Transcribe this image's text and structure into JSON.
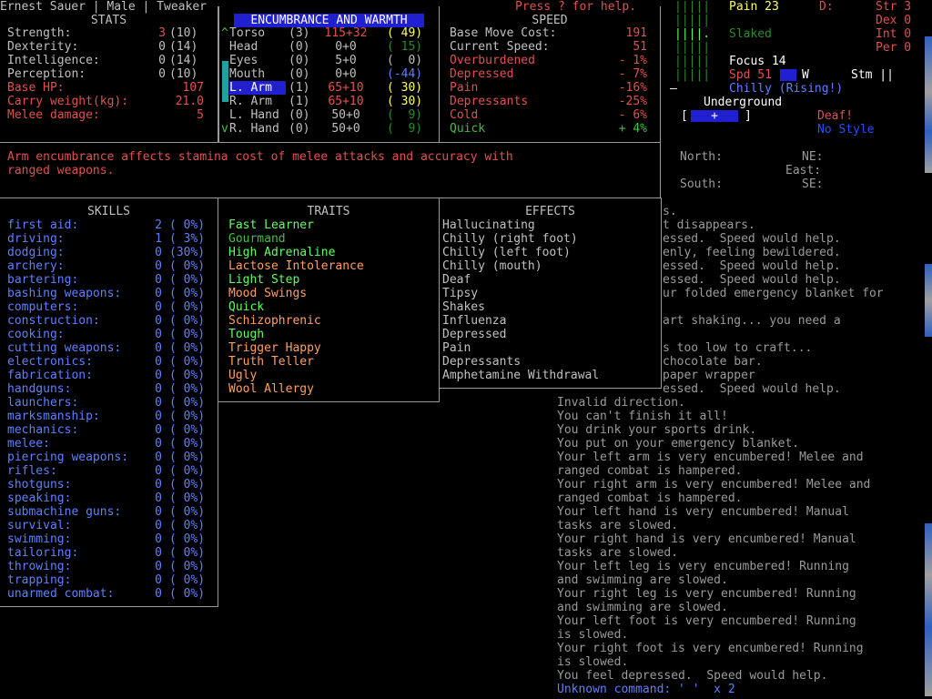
{
  "title": "Ernest Sauer | Male | Tweaker",
  "help": "Press ? for help.",
  "stats": {
    "header": "STATS",
    "rows": [
      {
        "label": "Strength:",
        "val": "3",
        "base": "(10)"
      },
      {
        "label": "Dexterity:",
        "val": "0",
        "base": "(14)"
      },
      {
        "label": "Intelligence:",
        "val": "0",
        "base": "(14)"
      },
      {
        "label": "Perception:",
        "val": "0",
        "base": "(10)"
      }
    ],
    "base_hp_label": "Base HP:",
    "base_hp": "107",
    "carry_label": "Carry weight(kg):",
    "carry": "21.0",
    "melee_label": "Melee damage:",
    "melee": "5"
  },
  "encumbrance": {
    "header": "ENCUMBRANCE AND WARMTH",
    "rows": [
      {
        "mark": "^",
        "part": "Torso",
        "layers": "(3)",
        "enc": "115+32",
        "warm": "( 49)",
        "enc_color": "red",
        "warm_color": "yel"
      },
      {
        "mark": "",
        "part": "Head",
        "layers": "(0)",
        "enc": "0+0",
        "warm": "( 15)",
        "enc_color": "gray",
        "warm_color": "dgrn"
      },
      {
        "mark": "",
        "part": "Eyes",
        "layers": "(0)",
        "enc": "5+0",
        "warm": "(  0)",
        "enc_color": "gray",
        "warm_color": "gray"
      },
      {
        "mark": "",
        "part": "Mouth",
        "layers": "(0)",
        "enc": "0+0",
        "warm": "(-44)",
        "enc_color": "gray",
        "warm_color": "blue"
      },
      {
        "mark": "",
        "part": "L. Arm",
        "layers": "(1)",
        "enc": "65+10",
        "warm": "( 30)",
        "enc_color": "red",
        "warm_color": "yel",
        "selected": true
      },
      {
        "mark": "",
        "part": "R. Arm",
        "layers": "(1)",
        "enc": "65+10",
        "warm": "( 30)",
        "enc_color": "red",
        "warm_color": "yel"
      },
      {
        "mark": "",
        "part": "L. Hand",
        "layers": "(0)",
        "enc": "50+0",
        "warm": "(  9)",
        "enc_color": "gray",
        "warm_color": "dgrn"
      },
      {
        "mark": "v",
        "part": "R. Hand",
        "layers": "(0)",
        "enc": "50+0",
        "warm": "(  9)",
        "enc_color": "gray",
        "warm_color": "dgrn"
      }
    ]
  },
  "speed": {
    "header": "SPEED",
    "rows": [
      {
        "label": "Base Move Cost:",
        "val": "191",
        "color": "gray",
        "vcolor": "red"
      },
      {
        "label": "Current Speed:",
        "val": "51",
        "color": "gray",
        "vcolor": "red"
      },
      {
        "label": "Overburdened",
        "val": "- 1%",
        "color": "red",
        "vcolor": "red"
      },
      {
        "label": "Depressed",
        "val": "- 7%",
        "color": "red",
        "vcolor": "red"
      },
      {
        "label": "Pain",
        "val": "-16%",
        "color": "red",
        "vcolor": "red"
      },
      {
        "label": "Depressants",
        "val": "-25%",
        "color": "red",
        "vcolor": "red"
      },
      {
        "label": "Cold",
        "val": "- 6%",
        "color": "red",
        "vcolor": "red"
      },
      {
        "label": "Quick",
        "val": "+ 4%",
        "color": "grn",
        "vcolor": "grn"
      }
    ]
  },
  "description": "Arm encumbrance affects stamina cost of melee attacks and accuracy with\nranged weapons.",
  "skills": {
    "header": "SKILLS",
    "rows": [
      {
        "name": "first aid:",
        "lvl": "2",
        "pct": "( 0%)"
      },
      {
        "name": "driving:",
        "lvl": "1",
        "pct": "( 3%)"
      },
      {
        "name": "dodging:",
        "lvl": "0",
        "pct": "(30%)"
      },
      {
        "name": "archery:",
        "lvl": "0",
        "pct": "( 0%)"
      },
      {
        "name": "bartering:",
        "lvl": "0",
        "pct": "( 0%)"
      },
      {
        "name": "bashing weapons:",
        "lvl": "0",
        "pct": "( 0%)"
      },
      {
        "name": "computers:",
        "lvl": "0",
        "pct": "( 0%)"
      },
      {
        "name": "construction:",
        "lvl": "0",
        "pct": "( 0%)"
      },
      {
        "name": "cooking:",
        "lvl": "0",
        "pct": "( 0%)"
      },
      {
        "name": "cutting weapons:",
        "lvl": "0",
        "pct": "( 0%)"
      },
      {
        "name": "electronics:",
        "lvl": "0",
        "pct": "( 0%)"
      },
      {
        "name": "fabrication:",
        "lvl": "0",
        "pct": "( 0%)"
      },
      {
        "name": "handguns:",
        "lvl": "0",
        "pct": "( 0%)"
      },
      {
        "name": "launchers:",
        "lvl": "0",
        "pct": "( 0%)"
      },
      {
        "name": "marksmanship:",
        "lvl": "0",
        "pct": "( 0%)"
      },
      {
        "name": "mechanics:",
        "lvl": "0",
        "pct": "( 0%)"
      },
      {
        "name": "melee:",
        "lvl": "0",
        "pct": "( 0%)"
      },
      {
        "name": "piercing weapons:",
        "lvl": "0",
        "pct": "( 0%)"
      },
      {
        "name": "rifles:",
        "lvl": "0",
        "pct": "( 0%)"
      },
      {
        "name": "shotguns:",
        "lvl": "0",
        "pct": "( 0%)"
      },
      {
        "name": "speaking:",
        "lvl": "0",
        "pct": "( 0%)"
      },
      {
        "name": "submachine guns:",
        "lvl": "0",
        "pct": "( 0%)"
      },
      {
        "name": "survival:",
        "lvl": "0",
        "pct": "( 0%)"
      },
      {
        "name": "swimming:",
        "lvl": "0",
        "pct": "( 0%)"
      },
      {
        "name": "tailoring:",
        "lvl": "0",
        "pct": "( 0%)"
      },
      {
        "name": "throwing:",
        "lvl": "0",
        "pct": "( 0%)"
      },
      {
        "name": "trapping:",
        "lvl": "0",
        "pct": "( 0%)"
      },
      {
        "name": "unarmed combat:",
        "lvl": "0",
        "pct": "( 0%)"
      }
    ]
  },
  "traits": {
    "header": "TRAITS",
    "rows": [
      {
        "name": "Fast Learner",
        "color": "lgrn"
      },
      {
        "name": "Gourmand",
        "color": "grn"
      },
      {
        "name": "High Adrenaline",
        "color": "lgrn"
      },
      {
        "name": "Lactose Intolerance",
        "color": "orange"
      },
      {
        "name": "Light Step",
        "color": "lgrn"
      },
      {
        "name": "Mood Swings",
        "color": "orange"
      },
      {
        "name": "Quick",
        "color": "lgrn"
      },
      {
        "name": "Schizophrenic",
        "color": "orange"
      },
      {
        "name": "Tough",
        "color": "lgrn"
      },
      {
        "name": "Trigger Happy",
        "color": "orange"
      },
      {
        "name": "Truth Teller",
        "color": "orange"
      },
      {
        "name": "Ugly",
        "color": "orange"
      },
      {
        "name": "Wool Allergy",
        "color": "orange"
      }
    ]
  },
  "effects": {
    "header": "EFFECTS",
    "rows": [
      "Hallucinating",
      "Chilly (right foot)",
      "Chilly (left foot)",
      "Chilly (mouth)",
      "Deaf",
      "Tipsy",
      "Shakes",
      "Influenza",
      "Depressed",
      "Pain",
      "Depressants",
      "Amphetamine Withdrawal"
    ]
  },
  "sidebar": {
    "pain": "Pain 23",
    "d_label": "D:",
    "slaked": "Slaked",
    "focus": "Focus 14",
    "spd": "Spd 51",
    "w": "W",
    "stm": "Stm ||",
    "chilly": "Chilly (Rising!)",
    "underground": "Underground",
    "deaf": "Deaf!",
    "nostyle": "No Style",
    "str": "Str 3",
    "dex": "Dex 0",
    "int": "Int 0",
    "per": "Per 0",
    "bars": [
      "|||||",
      "|||||",
      "||||.",
      "|||||",
      "|||||",
      "|||||"
    ],
    "dash": "—",
    "compass_box_l": "[",
    "compass_box_r": "]",
    "compass_plus": "+",
    "north": "North:",
    "ne": "NE:",
    "east": "East:",
    "south": "South:",
    "se": "SE:"
  },
  "log_partial": [
    "s.",
    "t disappears.",
    "essed.  Speed would help.",
    "enly, feeling bewildered.",
    "essed.  Speed would help.",
    "essed.  Speed would help.",
    "ur folded emergency blanket for",
    "",
    "art shaking... you need a",
    "",
    "s too low to craft...",
    "chocolate bar.",
    "paper wrapper",
    "essed.  Speed would help."
  ],
  "log": [
    {
      "t": "Invalid direction."
    },
    {
      "t": "You can't finish it all!"
    },
    {
      "t": "You drink your sports drink."
    },
    {
      "t": "You put on your emergency blanket."
    },
    {
      "t": "Your left arm is very encumbered! Melee and"
    },
    {
      "t": "ranged combat is hampered."
    },
    {
      "t": "Your right arm is very encumbered! Melee and"
    },
    {
      "t": "ranged combat is hampered."
    },
    {
      "t": "Your left hand is very encumbered! Manual"
    },
    {
      "t": "tasks are slowed."
    },
    {
      "t": "Your right hand is very encumbered! Manual"
    },
    {
      "t": "tasks are slowed."
    },
    {
      "t": "Your left leg is very encumbered! Running"
    },
    {
      "t": "and swimming are slowed."
    },
    {
      "t": "Your right leg is very encumbered! Running"
    },
    {
      "t": "and swimming are slowed."
    },
    {
      "t": "Your left foot is very encumbered! Running"
    },
    {
      "t": "is slowed."
    },
    {
      "t": "Your right foot is very encumbered! Running"
    },
    {
      "t": "is slowed."
    },
    {
      "t": "You feel depressed.  Speed would help."
    }
  ],
  "last_msg": "Unknown command: ' '  x 2"
}
